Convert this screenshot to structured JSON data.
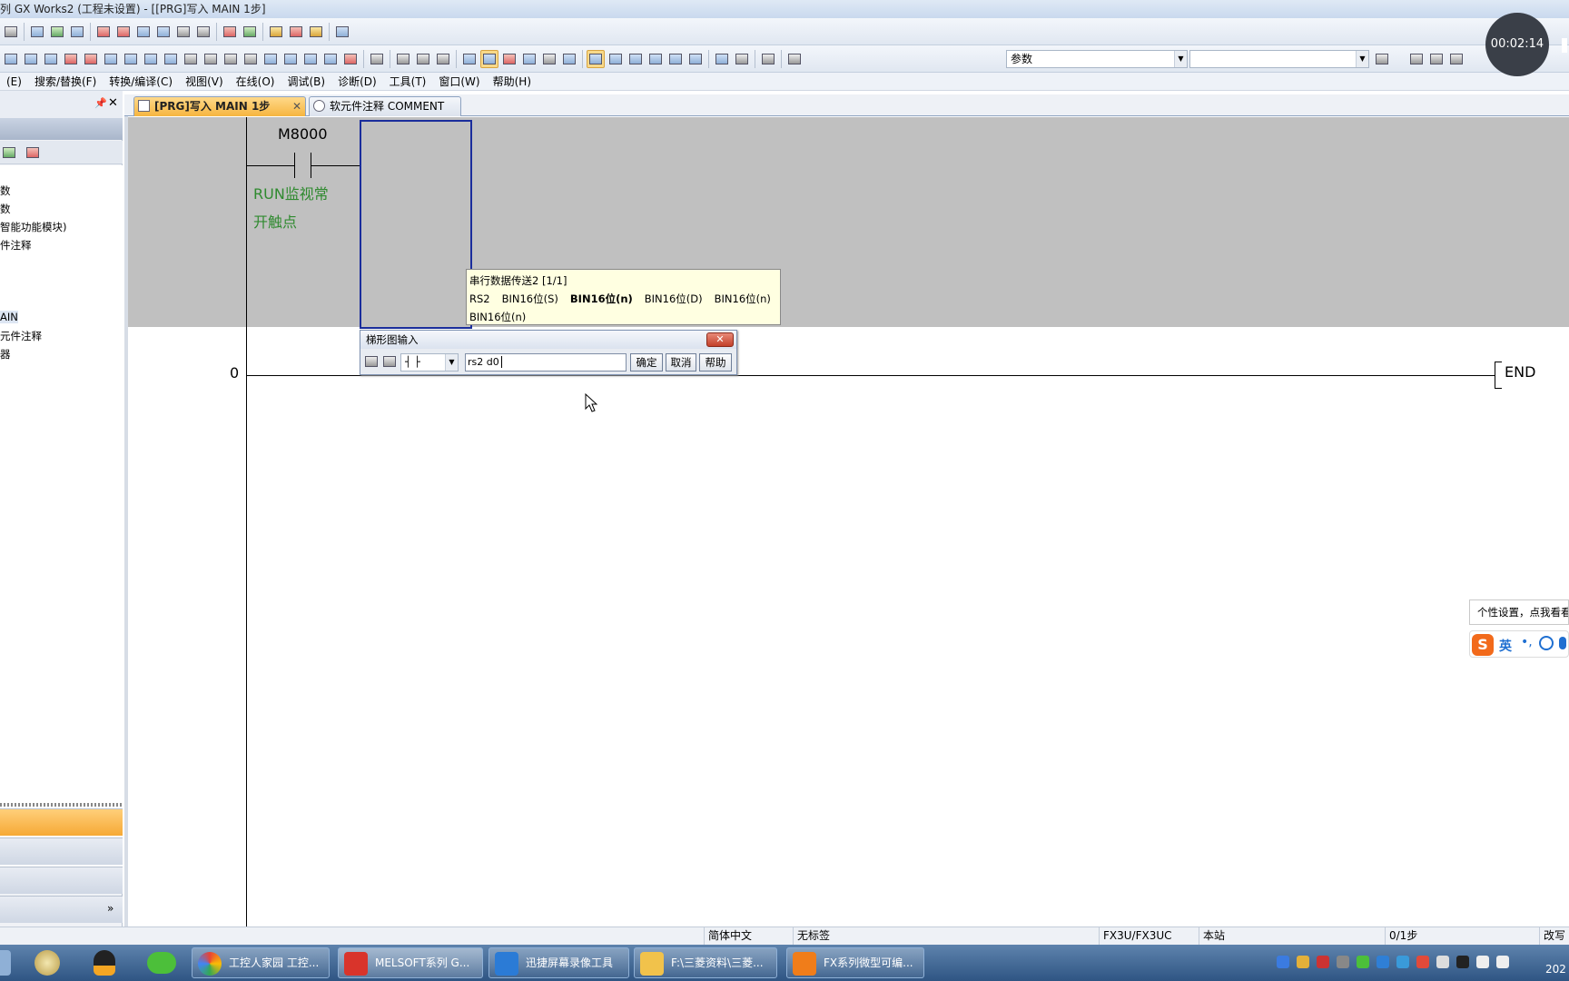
{
  "window": {
    "title": "列 GX Works2 (工程未设置) - [[PRG]写入 MAIN 1步]"
  },
  "toolbar": {
    "parameter_combo": "参数",
    "f_keys": [
      "F7",
      "F8",
      "F9",
      "sF9",
      "cF9",
      "cF10",
      "sF7",
      "sF8",
      "aF7",
      "aF8",
      "saF5",
      "saF6",
      "saF7",
      "saF8",
      "aF5",
      "caF5",
      "caF10",
      "F10",
      "aF9"
    ]
  },
  "menu": {
    "items": [
      "(E)",
      "搜索/替换(F)",
      "转换/编译(C)",
      "视图(V)",
      "在线(O)",
      "调试(B)",
      "诊断(D)",
      "工具(T)",
      "窗口(W)",
      "帮助(H)"
    ]
  },
  "project_tree": {
    "items": [
      "数",
      "数",
      "智能功能模块)",
      "件注释",
      "AIN",
      "元件注释",
      "器"
    ]
  },
  "tabs": [
    {
      "label": "[PRG]写入 MAIN 1步",
      "active": true
    },
    {
      "label": "软元件注释 COMMENT",
      "active": false
    }
  ],
  "ladder": {
    "contact_device": "M8000",
    "contact_comment_line1": "RUN监视常",
    "contact_comment_line2": "开触点",
    "step_number": "0",
    "end_label": "END"
  },
  "tooltip": {
    "header": "串行数据传送2 [1/1]",
    "instruction": "RS2",
    "operands": [
      "BIN16位(S)",
      "BIN16位(n)",
      "BIN16位(D)",
      "BIN16位(n)"
    ],
    "highlighted_index": 1,
    "last_operand": "BIN16位(n)"
  },
  "ladder_input_dialog": {
    "title": "梯形图输入",
    "symbol_select": "┤ ├",
    "input_value": "rs2 d0",
    "ok_label": "确定",
    "cancel_label": "取消",
    "help_label": "帮助"
  },
  "status_bar": {
    "language": "简体中文",
    "label": "无标签",
    "cpu": "FX3U/FX3UC",
    "station": "本站",
    "steps": "0/1步",
    "mode": "改写"
  },
  "taskbar": {
    "items": [
      "工控人家园 工控...",
      "MELSOFT系列 G...",
      "迅捷屏幕录像工具",
      "F:\\三菱资料\\三菱...",
      "FX系列微型可编..."
    ],
    "clock_partial": "202"
  },
  "recorder": {
    "elapsed": "00:02:14"
  },
  "ime": {
    "tip": "个性设置，点我看看",
    "mode": "英"
  },
  "colors": {
    "active_tab": "#f6b53f",
    "ladder_gray": "#c0c0c0",
    "comment_green": "#2f8a2f",
    "cursor_blue": "#1a2d9c",
    "tooltip_bg": "#ffffe1"
  }
}
